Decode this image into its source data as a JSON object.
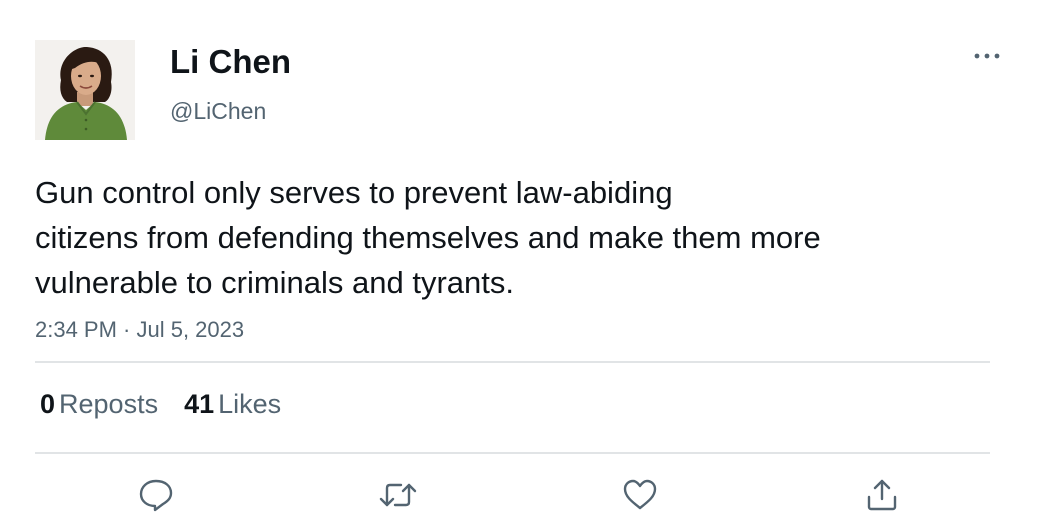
{
  "author": {
    "display_name": "Li Chen",
    "handle": "@LiChen"
  },
  "tweet": {
    "text_lines": [
      "Gun control only serves to prevent law-abiding",
      "citizens from defending themselves and make them more",
      "vulnerable to criminals and tyrants."
    ],
    "timestamp": "2:34 PM · Jul 5, 2023"
  },
  "stats": {
    "reposts_count": "0",
    "reposts_label": "Reposts",
    "likes_count": "41",
    "likes_label": "Likes"
  },
  "icons": {
    "more": "more-horizontal-icon",
    "reply": "reply-icon",
    "repost": "repost-icon",
    "like": "heart-icon",
    "share": "share-icon"
  },
  "colors": {
    "text_primary": "#0f1419",
    "text_secondary": "#536471",
    "divider": "#e1e4e6"
  }
}
